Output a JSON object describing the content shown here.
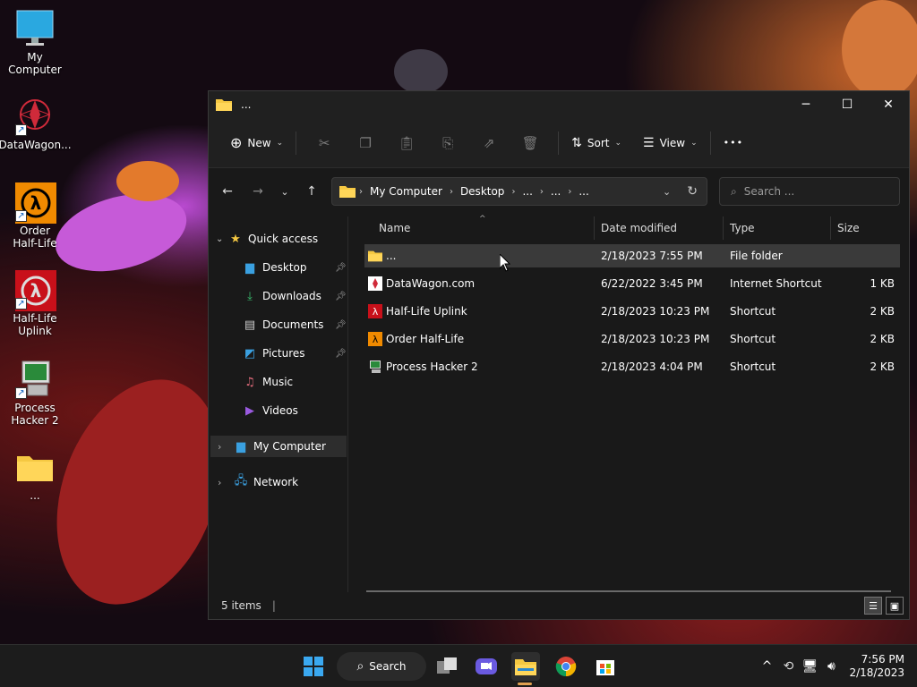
{
  "desktop": {
    "icons": [
      {
        "label": "My Computer"
      },
      {
        "label": "DataWagon..."
      },
      {
        "label": "Order Half-Life"
      },
      {
        "label": "Half-Life Uplink"
      },
      {
        "label": "Process Hacker 2"
      },
      {
        "label": "..."
      }
    ]
  },
  "window": {
    "title": "...",
    "controls": {
      "minimize": "─",
      "maximize": "☐",
      "close": "✕"
    }
  },
  "toolbar": {
    "new_label": "New",
    "sort_label": "Sort",
    "view_label": "View",
    "more_label": "•••"
  },
  "address": {
    "crumbs": [
      "My Computer",
      "Desktop",
      "...",
      "...",
      "..."
    ]
  },
  "search": {
    "placeholder": "Search ..."
  },
  "navpane": {
    "quick_access": "Quick access",
    "items": [
      {
        "label": "Desktop",
        "pinned": true
      },
      {
        "label": "Downloads",
        "pinned": true
      },
      {
        "label": "Documents",
        "pinned": true
      },
      {
        "label": "Pictures",
        "pinned": true
      },
      {
        "label": "Music",
        "pinned": false
      },
      {
        "label": "Videos",
        "pinned": false
      }
    ],
    "my_computer": "My Computer",
    "network": "Network"
  },
  "filelist": {
    "columns": [
      "Name",
      "Date modified",
      "Type",
      "Size"
    ],
    "rows": [
      {
        "name": "...",
        "date": "2/18/2023 7:55 PM",
        "type": "File folder",
        "size": ""
      },
      {
        "name": "DataWagon.com",
        "date": "6/22/2022 3:45 PM",
        "type": "Internet Shortcut",
        "size": "1 KB"
      },
      {
        "name": "Half-Life Uplink",
        "date": "2/18/2023 10:23 PM",
        "type": "Shortcut",
        "size": "2 KB"
      },
      {
        "name": "Order Half-Life",
        "date": "2/18/2023 10:23 PM",
        "type": "Shortcut",
        "size": "2 KB"
      },
      {
        "name": "Process Hacker 2",
        "date": "2/18/2023 4:04 PM",
        "type": "Shortcut",
        "size": "2 KB"
      }
    ]
  },
  "status": {
    "items_count": "5 items"
  },
  "taskbar": {
    "search_label": "Search",
    "time": "7:56 PM",
    "date": "2/18/2023"
  }
}
